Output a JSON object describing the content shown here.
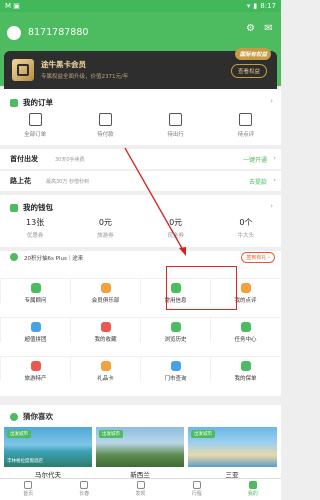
{
  "status": {
    "left_icons": "M  ▣",
    "right": "8:17"
  },
  "user": {
    "phone": "8171787880"
  },
  "header_icons": [
    "settings-icon",
    "message-icon"
  ],
  "member": {
    "badge": "国际有权益",
    "title": "途牛黑卡会员",
    "subtitle": "专属权益全面升级，价值2371元/年",
    "button": "查看权益"
  },
  "orders": {
    "title": "我的订单",
    "chevron": "›",
    "items": [
      "全部订单",
      "待付款",
      "待出行",
      "待点评"
    ]
  },
  "first_pay": {
    "title": "首付出发",
    "sub": "30天0手续费",
    "action": "一键开通",
    "chevron": "›"
  },
  "road_flower": {
    "title": "路上花",
    "sub": "最高30万 秒借秒到",
    "action": "去提款",
    "chevron": "›"
  },
  "wallet": {
    "title": "我的钱包",
    "chevron": "›",
    "items": [
      {
        "value": "13张",
        "label": "优惠券"
      },
      {
        "value": "0元",
        "label": "旅游券"
      },
      {
        "value": "0元",
        "label": "现金券"
      },
      {
        "value": "0个",
        "label": "牛大头"
      }
    ]
  },
  "promo": {
    "text": "20积分抽6s Plus｜途来",
    "button": "签到有礼 ›"
  },
  "grid": [
    "专属顾问",
    "会员俱乐部",
    "常用信息",
    "我的点评",
    "超值拼团",
    "我的收藏",
    "浏览历史",
    "任务中心",
    "旅游特产",
    "礼品卡",
    "门市查询",
    "我的保单"
  ],
  "guess": {
    "title": "猜你喜欢",
    "items": [
      {
        "tag": "出发城市",
        "caption": "丰林格拉度假酒店",
        "name": "马尔代夫"
      },
      {
        "tag": "出发城市",
        "caption": "",
        "name": "新西兰"
      },
      {
        "tag": "出发城市",
        "caption": "",
        "name": "三亚"
      }
    ]
  },
  "tabs": [
    "首页",
    "长春",
    "发现",
    "行程",
    "我的"
  ]
}
